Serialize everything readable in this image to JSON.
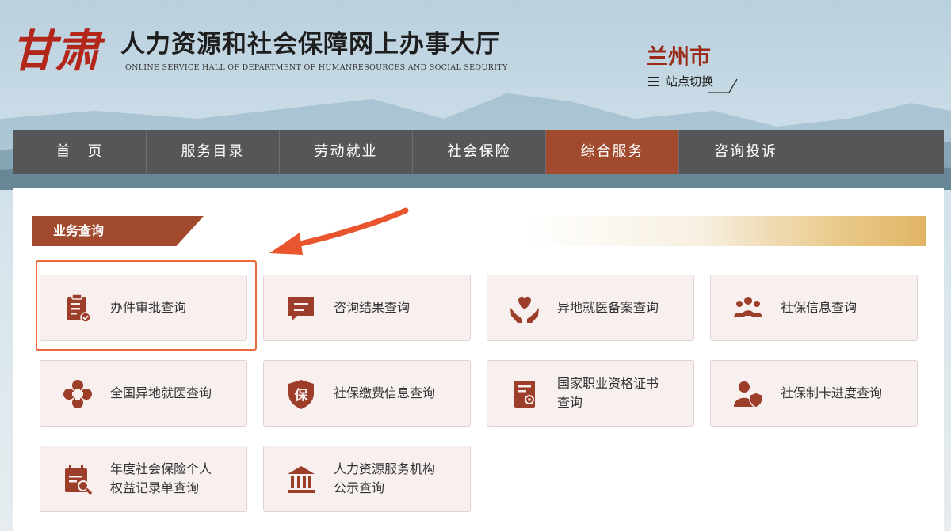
{
  "header": {
    "logo_text": "甘肃",
    "title": "人力资源和社会保障网上办事大厅",
    "subtitle": "ONLINE SERVICE HALL OF DEPARTMENT OF HUMANRESOURCES AND SOCIAL SEQURITY",
    "city": "兰州市",
    "switch_label": "站点切换"
  },
  "nav": {
    "items": [
      {
        "label": "首　页",
        "active": false
      },
      {
        "label": "服务目录",
        "active": false
      },
      {
        "label": "劳动就业",
        "active": false
      },
      {
        "label": "社会保险",
        "active": false
      },
      {
        "label": "综合服务",
        "active": true
      },
      {
        "label": "咨询投诉",
        "active": false
      }
    ]
  },
  "section": {
    "title": "业务查询"
  },
  "cards": [
    {
      "label": "办件审批查询",
      "icon": "clipboard-check-icon"
    },
    {
      "label": "咨询结果查询",
      "icon": "chat-bubble-icon"
    },
    {
      "label": "异地就医备案查询",
      "icon": "heart-hands-icon"
    },
    {
      "label": "社保信息查询",
      "icon": "people-group-icon"
    },
    {
      "label": "全国异地就医查询",
      "icon": "medical-cross-icon"
    },
    {
      "label": "社保缴费信息查询",
      "icon": "shield-bao-icon"
    },
    {
      "label": "国家职业资格证书\n查询",
      "icon": "certificate-icon"
    },
    {
      "label": "社保制卡进度查询",
      "icon": "user-shield-icon"
    },
    {
      "label": "年度社会保险个人\n权益记录单查询",
      "icon": "calendar-search-icon"
    },
    {
      "label": "人力资源服务机构\n公示查询",
      "icon": "institution-building-icon"
    }
  ],
  "colors": {
    "accent": "#a14a2e",
    "nav_bg": "#555657",
    "highlight": "#e86a3a",
    "card_bg": "#f8efef"
  }
}
